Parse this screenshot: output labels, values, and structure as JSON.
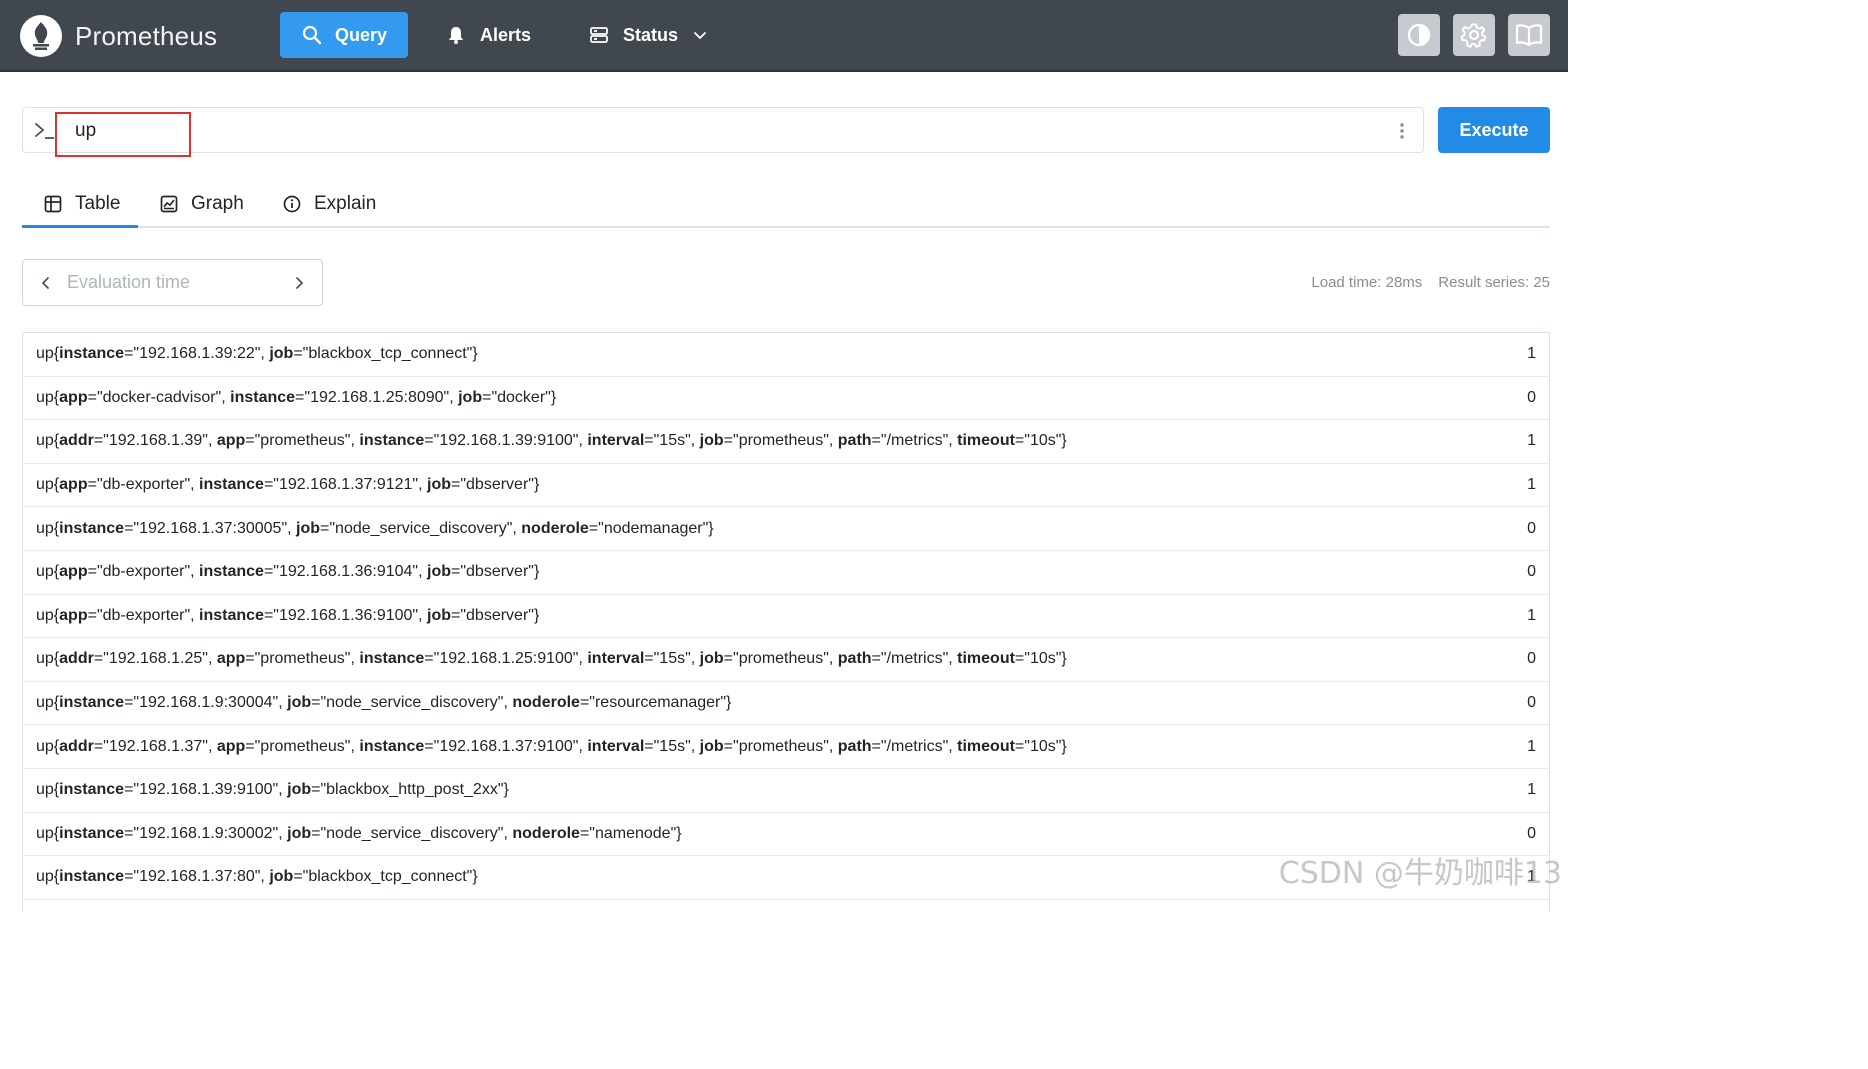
{
  "app": {
    "title": "Prometheus"
  },
  "nav": {
    "query_label": "Query",
    "alerts_label": "Alerts",
    "status_label": "Status",
    "accent_color": "#339af0",
    "icons": [
      "prometheus-logo",
      "search-icon",
      "bell-icon",
      "server-icon",
      "chevron-down-icon",
      "contrast-icon",
      "gear-icon",
      "book-icon"
    ]
  },
  "query": {
    "value": "up",
    "execute_label": "Execute"
  },
  "tabs": [
    {
      "label": "Table",
      "icon": "table-icon",
      "active": true
    },
    {
      "label": "Graph",
      "icon": "graph-icon",
      "active": false
    },
    {
      "label": "Explain",
      "icon": "info-icon",
      "active": false
    }
  ],
  "eval": {
    "placeholder": "Evaluation time"
  },
  "stats": {
    "load_time": "Load time: 28ms",
    "result_series": "Result series: 25"
  },
  "results": [
    {
      "metric": "up",
      "labels": [
        [
          "instance",
          "192.168.1.39:22"
        ],
        [
          "job",
          "blackbox_tcp_connect"
        ]
      ],
      "value": "1"
    },
    {
      "metric": "up",
      "labels": [
        [
          "app",
          "docker-cadvisor"
        ],
        [
          "instance",
          "192.168.1.25:8090"
        ],
        [
          "job",
          "docker"
        ]
      ],
      "value": "0"
    },
    {
      "metric": "up",
      "labels": [
        [
          "addr",
          "192.168.1.39"
        ],
        [
          "app",
          "prometheus"
        ],
        [
          "instance",
          "192.168.1.39:9100"
        ],
        [
          "interval",
          "15s"
        ],
        [
          "job",
          "prometheus"
        ],
        [
          "path",
          "/metrics"
        ],
        [
          "timeout",
          "10s"
        ]
      ],
      "value": "1"
    },
    {
      "metric": "up",
      "labels": [
        [
          "app",
          "db-exporter"
        ],
        [
          "instance",
          "192.168.1.37:9121"
        ],
        [
          "job",
          "dbserver"
        ]
      ],
      "value": "1"
    },
    {
      "metric": "up",
      "labels": [
        [
          "instance",
          "192.168.1.37:30005"
        ],
        [
          "job",
          "node_service_discovery"
        ],
        [
          "noderole",
          "nodemanager"
        ]
      ],
      "value": "0"
    },
    {
      "metric": "up",
      "labels": [
        [
          "app",
          "db-exporter"
        ],
        [
          "instance",
          "192.168.1.36:9104"
        ],
        [
          "job",
          "dbserver"
        ]
      ],
      "value": "0"
    },
    {
      "metric": "up",
      "labels": [
        [
          "app",
          "db-exporter"
        ],
        [
          "instance",
          "192.168.1.36:9100"
        ],
        [
          "job",
          "dbserver"
        ]
      ],
      "value": "1"
    },
    {
      "metric": "up",
      "labels": [
        [
          "addr",
          "192.168.1.25"
        ],
        [
          "app",
          "prometheus"
        ],
        [
          "instance",
          "192.168.1.25:9100"
        ],
        [
          "interval",
          "15s"
        ],
        [
          "job",
          "prometheus"
        ],
        [
          "path",
          "/metrics"
        ],
        [
          "timeout",
          "10s"
        ]
      ],
      "value": "0"
    },
    {
      "metric": "up",
      "labels": [
        [
          "instance",
          "192.168.1.9:30004"
        ],
        [
          "job",
          "node_service_discovery"
        ],
        [
          "noderole",
          "resourcemanager"
        ]
      ],
      "value": "0"
    },
    {
      "metric": "up",
      "labels": [
        [
          "addr",
          "192.168.1.37"
        ],
        [
          "app",
          "prometheus"
        ],
        [
          "instance",
          "192.168.1.37:9100"
        ],
        [
          "interval",
          "15s"
        ],
        [
          "job",
          "prometheus"
        ],
        [
          "path",
          "/metrics"
        ],
        [
          "timeout",
          "10s"
        ]
      ],
      "value": "1"
    },
    {
      "metric": "up",
      "labels": [
        [
          "instance",
          "192.168.1.39:9100"
        ],
        [
          "job",
          "blackbox_http_post_2xx"
        ]
      ],
      "value": "1"
    },
    {
      "metric": "up",
      "labels": [
        [
          "instance",
          "192.168.1.9:30002"
        ],
        [
          "job",
          "node_service_discovery"
        ],
        [
          "noderole",
          "namenode"
        ]
      ],
      "value": "0"
    },
    {
      "metric": "up",
      "labels": [
        [
          "instance",
          "192.168.1.37:80"
        ],
        [
          "job",
          "blackbox_tcp_connect"
        ]
      ],
      "value": "1"
    }
  ],
  "watermark": "CSDN @牛奶咖啡13"
}
